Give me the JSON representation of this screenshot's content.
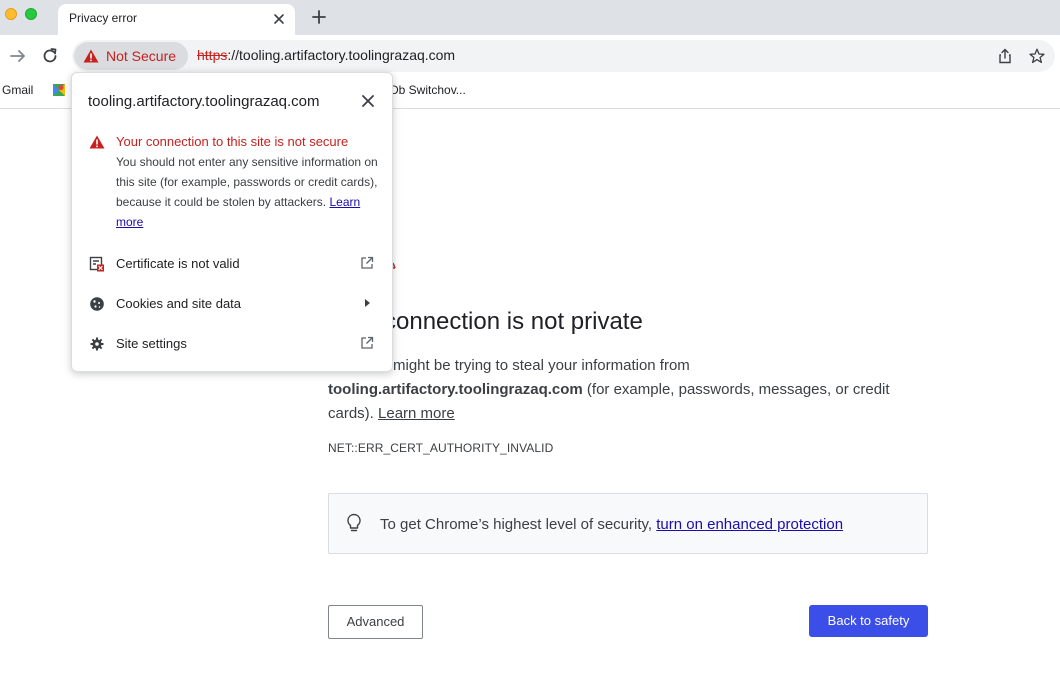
{
  "tab": {
    "title": "Privacy error",
    "close_icon": "close-icon",
    "new_tab_icon": "plus-icon"
  },
  "toolbar": {
    "back_icon": "arrow-left-icon",
    "forward_icon": "arrow-right-icon",
    "reload_icon": "reload-icon",
    "security_chip": "Not Secure",
    "url_scheme": "https",
    "url_rest": "://tooling.artifactory.toolingrazaq.com",
    "share_icon": "share-icon",
    "bookmark_icon": "star-icon"
  },
  "bookmarks": {
    "items": [
      "Gmail",
      "Db Switchov..."
    ],
    "maps_icon": "maps-icon"
  },
  "interstitial": {
    "heading": "connection is not private",
    "body_line1": "might be trying to steal your information from",
    "hostname": "tooling.artifactory.toolingrazaq.com",
    "body_line2_rest": " (for example, passwords, messages, or credit",
    "body_line3_start": "cards). ",
    "learn_more": "Learn more",
    "error_code": "NET::ERR_CERT_AUTHORITY_INVALID",
    "protection_text": "To get Chrome’s highest level of security, ",
    "protection_link": "turn on enhanced protection",
    "advanced_button": "Advanced",
    "safety_button": "Back to safety"
  },
  "popup": {
    "host": "tooling.artifactory.toolingrazaq.com",
    "warning_title": "Your connection to this site is not secure",
    "warning_body": "You should not enter any sensitive information on this site (for example, passwords or credit cards), because it could be stolen by attackers. ",
    "learn_more": "Learn more",
    "rows": [
      {
        "label": "Certificate is not valid",
        "icon": "certificate-error-icon",
        "trail": "external-link-icon"
      },
      {
        "label": "Cookies and site data",
        "icon": "cookie-icon",
        "trail": "arrow-right-icon"
      },
      {
        "label": "Site settings",
        "icon": "gear-icon",
        "trail": "external-link-icon"
      }
    ]
  },
  "colors": {
    "danger": "#c5221f",
    "primary_button": "#3b4ee8",
    "link": "#1a0dab"
  }
}
